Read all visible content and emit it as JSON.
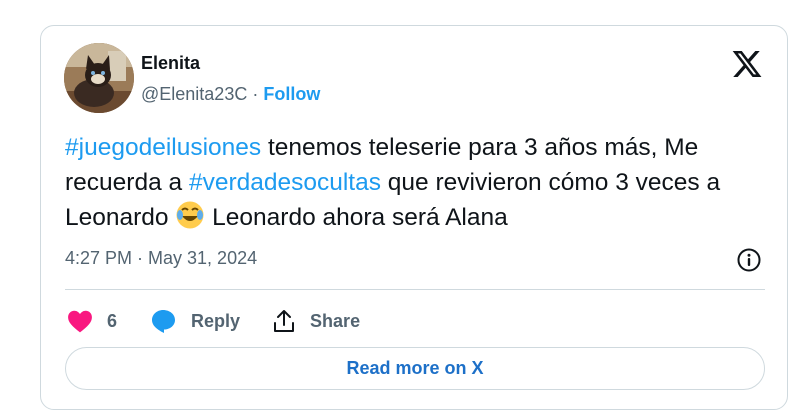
{
  "author": {
    "display_name": "Elenita",
    "handle": "@Elenita23C",
    "separator": " · ",
    "follow_label": "Follow",
    "avatar_icon": "cat-avatar"
  },
  "brand": {
    "logo_icon": "x-logo-icon"
  },
  "tweet": {
    "hashtag_1": "#juegodeilusiones",
    "text_1": " tenemos teleserie para 3 años más, Me recuerda a ",
    "hashtag_2": "#verdadesocultas",
    "text_2": " que revivieron cómo 3 veces a Leonardo ",
    "emoji": "face-with-tears-of-joy",
    "text_3": " Leonardo ahora será Alana",
    "timestamp": "4:27 PM · May 31, 2024"
  },
  "actions": {
    "like_count": "6",
    "reply_label": "Reply",
    "share_label": "Share"
  },
  "footer": {
    "read_more_label": "Read more on X"
  },
  "colors": {
    "accent": "#1d9bf0",
    "like": "#f91880",
    "text": "#0f1419",
    "muted": "#536471",
    "border": "#cfd9de"
  }
}
